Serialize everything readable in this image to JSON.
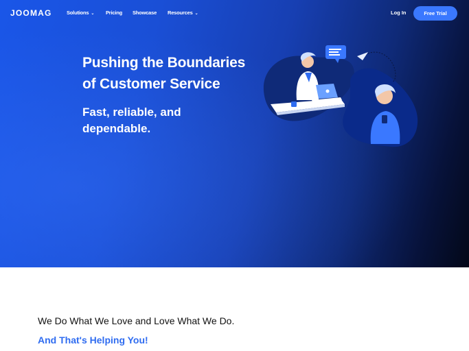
{
  "nav": {
    "logo": "JOOMAG",
    "items": [
      {
        "label": "Solutions",
        "dropdown": true
      },
      {
        "label": "Pricing",
        "dropdown": false
      },
      {
        "label": "Showcase",
        "dropdown": false
      },
      {
        "label": "Resources",
        "dropdown": true
      }
    ],
    "login": "Log In",
    "trial": "Free Trial"
  },
  "hero": {
    "title_line1": "Pushing the Boundaries",
    "title_line2": "of Customer Service",
    "subtitle_line1": "Fast, reliable, and",
    "subtitle_line2": "dependable."
  },
  "section": {
    "line1": "We Do What We Love and Love What We Do.",
    "line2": "And That's Helping You!"
  },
  "colors": {
    "accent": "#3a78ff",
    "hero_start": "#1a56e8",
    "hero_end": "#030818",
    "highlight_text": "#2f6cf0"
  },
  "icons": [
    "chevron-down-icon",
    "paper-plane-icon",
    "chat-bubble-icon"
  ]
}
